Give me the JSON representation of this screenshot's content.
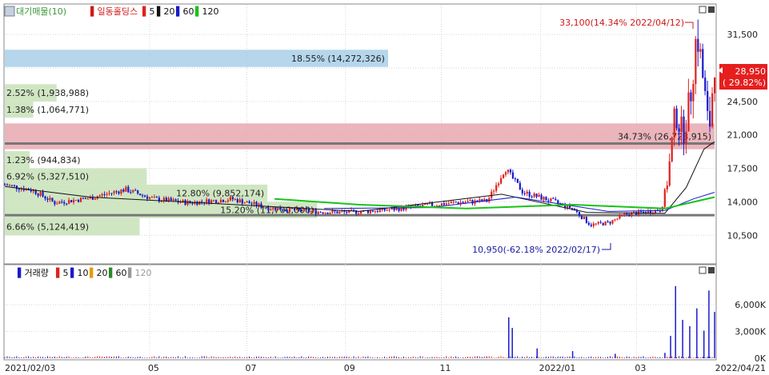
{
  "legend": {
    "price_label": "대기매물(10)",
    "stock_name": "일동홀딩스",
    "ma": [
      {
        "label": "5",
        "color": "#e0201c"
      },
      {
        "label": "20",
        "color": "#111111"
      },
      {
        "label": "60",
        "color": "#1a1acc"
      },
      {
        "label": "120",
        "color": "#18c418"
      }
    ]
  },
  "volume_legend": {
    "label": "거래량",
    "ma": [
      {
        "label": "5",
        "color": "#e0201c"
      },
      {
        "label": "10",
        "color": "#1a1acc"
      },
      {
        "label": "20",
        "color": "#e69a00"
      },
      {
        "label": "60",
        "color": "#2a8a2a"
      },
      {
        "label": "120",
        "color": "#999999"
      }
    ]
  },
  "annotations": {
    "high": "33,100(14.34% 2022/04/12)",
    "low": "10,950(-62.18% 2022/02/17)",
    "current_price": "28,950",
    "current_change": "( 29.82%)"
  },
  "x_axis": {
    "start_label": "2021/02/03",
    "ticks": [
      "05",
      "07",
      "09",
      "11",
      "2022/01",
      "03"
    ],
    "end_label": "2022/04/21"
  },
  "price_ticks": [
    "31,500",
    "28,000",
    "24,500",
    "21,000",
    "17,500",
    "14,000",
    "10,500"
  ],
  "volume_ticks": [
    "6,000K",
    "3,000K",
    "0K"
  ],
  "chart_data": {
    "type": "candlestick",
    "title": "일동홀딩스",
    "date_range": [
      "2021/02/03",
      "2022/04/21"
    ],
    "price_axis": {
      "ylim": [
        7600,
        34600
      ],
      "ticks": [
        10500,
        14000,
        17500,
        21000,
        24500,
        28000,
        31500
      ]
    },
    "volume_axis": {
      "ylim": [
        0,
        8800
      ],
      "unit": "K",
      "ticks": [
        0,
        3000,
        6000
      ]
    },
    "volume_profile": [
      {
        "label": "18.55% (14,272,326)",
        "price_low": 28100,
        "price_high": 29900,
        "fraction": 0.54,
        "color": "#a8cfe8"
      },
      {
        "label": "2.52% (1,938,988)",
        "price_low": 24500,
        "price_high": 26300,
        "fraction": 0.073,
        "color": "#c8e2b8"
      },
      {
        "label": "1.38% (1,064,771)",
        "price_low": 22800,
        "price_high": 24500,
        "fraction": 0.04,
        "color": "#c8e2b8"
      },
      {
        "label": "34.73% (26,723,915)",
        "price_low": 19500,
        "price_high": 22200,
        "fraction": 1.0,
        "color": "#e8a8b0"
      },
      {
        "label": "1.23% (944,834)",
        "price_low": 17500,
        "price_high": 19300,
        "fraction": 0.035,
        "color": "#c8e2b8"
      },
      {
        "label": "6.92% (5,327,510)",
        "price_low": 15800,
        "price_high": 17500,
        "fraction": 0.2,
        "color": "#c8e2b8"
      },
      {
        "label": "12.80% (9,852,174)",
        "price_low": 14000,
        "price_high": 15800,
        "fraction": 0.37,
        "color": "#c8e2b8"
      },
      {
        "label": "15.20% (11,700,000)",
        "price_low": 12300,
        "price_high": 14000,
        "fraction": 0.44,
        "color": "#c8e2b8"
      },
      {
        "label": "6.66% (5,124,419)",
        "price_low": 10500,
        "price_high": 12300,
        "fraction": 0.19,
        "color": "#c8e2b8"
      }
    ],
    "horizontal_lines": [
      {
        "price": 20100,
        "color": "#777777"
      },
      {
        "price": 12600,
        "color": "#777777"
      }
    ],
    "high": {
      "date": "2022/04/12",
      "price": 33100
    },
    "low": {
      "date": "2022/02/17",
      "price": 10950
    },
    "last": {
      "date": "2022/04/21",
      "price": 28950,
      "change_pct": 29.82
    },
    "price_path": [
      {
        "t": 0.0,
        "p": 15800
      },
      {
        "t": 0.04,
        "p": 15200
      },
      {
        "t": 0.07,
        "p": 13900
      },
      {
        "t": 0.12,
        "p": 14400
      },
      {
        "t": 0.17,
        "p": 15300
      },
      {
        "t": 0.21,
        "p": 14300
      },
      {
        "t": 0.26,
        "p": 13900
      },
      {
        "t": 0.32,
        "p": 14300
      },
      {
        "t": 0.37,
        "p": 13400
      },
      {
        "t": 0.43,
        "p": 13000
      },
      {
        "t": 0.48,
        "p": 12900
      },
      {
        "t": 0.53,
        "p": 13100
      },
      {
        "t": 0.58,
        "p": 13500
      },
      {
        "t": 0.63,
        "p": 13900
      },
      {
        "t": 0.68,
        "p": 14100
      },
      {
        "t": 0.705,
        "p": 17500
      },
      {
        "t": 0.73,
        "p": 15000
      },
      {
        "t": 0.77,
        "p": 14100
      },
      {
        "t": 0.8,
        "p": 13300
      },
      {
        "t": 0.825,
        "p": 11600
      },
      {
        "t": 0.85,
        "p": 11800
      },
      {
        "t": 0.875,
        "p": 12700
      },
      {
        "t": 0.9,
        "p": 12900
      },
      {
        "t": 0.925,
        "p": 13200
      },
      {
        "t": 0.935,
        "p": 17000
      },
      {
        "t": 0.945,
        "p": 23500
      },
      {
        "t": 0.955,
        "p": 21000
      },
      {
        "t": 0.965,
        "p": 24500
      },
      {
        "t": 0.975,
        "p": 32000
      },
      {
        "t": 0.985,
        "p": 26000
      },
      {
        "t": 0.992,
        "p": 21000
      },
      {
        "t": 1.0,
        "p": 28950
      }
    ],
    "ma_lines": [
      {
        "name": "20",
        "color": "#111111",
        "points": [
          {
            "t": 0.0,
            "p": 15600
          },
          {
            "t": 0.12,
            "p": 14500
          },
          {
            "t": 0.3,
            "p": 13800
          },
          {
            "t": 0.5,
            "p": 13000
          },
          {
            "t": 0.7,
            "p": 14800
          },
          {
            "t": 0.82,
            "p": 12900
          },
          {
            "t": 0.93,
            "p": 12800
          },
          {
            "t": 0.96,
            "p": 15500
          },
          {
            "t": 0.985,
            "p": 19500
          },
          {
            "t": 1.0,
            "p": 20300
          }
        ]
      },
      {
        "name": "60",
        "color": "#1a1acc",
        "points": [
          {
            "t": 0.45,
            "p": 13300
          },
          {
            "t": 0.6,
            "p": 13400
          },
          {
            "t": 0.72,
            "p": 14500
          },
          {
            "t": 0.85,
            "p": 13000
          },
          {
            "t": 0.93,
            "p": 13100
          },
          {
            "t": 0.97,
            "p": 14300
          },
          {
            "t": 1.0,
            "p": 15000
          }
        ]
      },
      {
        "name": "120",
        "color": "#18c418",
        "points": [
          {
            "t": 0.38,
            "p": 14300
          },
          {
            "t": 0.5,
            "p": 13700
          },
          {
            "t": 0.65,
            "p": 13300
          },
          {
            "t": 0.8,
            "p": 13700
          },
          {
            "t": 0.93,
            "p": 13300
          },
          {
            "t": 1.0,
            "p": 14500
          }
        ]
      }
    ],
    "volume_spikes": [
      {
        "t": 0.71,
        "v": 4600
      },
      {
        "t": 0.715,
        "v": 3400
      },
      {
        "t": 0.75,
        "v": 1100
      },
      {
        "t": 0.8,
        "v": 800
      },
      {
        "t": 0.86,
        "v": 500
      },
      {
        "t": 0.93,
        "v": 600
      },
      {
        "t": 0.938,
        "v": 2500
      },
      {
        "t": 0.945,
        "v": 8100
      },
      {
        "t": 0.955,
        "v": 4300
      },
      {
        "t": 0.965,
        "v": 3600
      },
      {
        "t": 0.975,
        "v": 5600
      },
      {
        "t": 0.985,
        "v": 3100
      },
      {
        "t": 0.992,
        "v": 7600
      },
      {
        "t": 1.0,
        "v": 5200
      }
    ]
  }
}
